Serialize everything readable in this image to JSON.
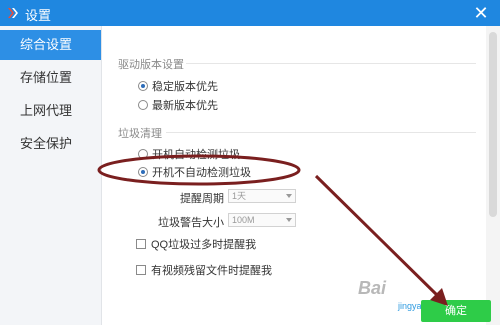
{
  "window": {
    "title": "设置",
    "close_glyph": "✕",
    "accent": "#1f87e0"
  },
  "sidebar": {
    "items": [
      {
        "label": "综合设置",
        "active": true
      },
      {
        "label": "存储位置",
        "active": false
      },
      {
        "label": "上网代理",
        "active": false
      },
      {
        "label": "安全保护",
        "active": false
      }
    ]
  },
  "driver_section": {
    "title": "驱动版本设置",
    "options": [
      {
        "label": "稳定版本优先",
        "checked": true
      },
      {
        "label": "最新版本优先",
        "checked": false
      }
    ]
  },
  "junk_section": {
    "title": "垃圾清理",
    "options": [
      {
        "label": "开机自动检测垃圾",
        "checked": false
      },
      {
        "label": "开机不自动检测垃圾",
        "checked": true
      }
    ],
    "remind_period": {
      "label": "提醒周期",
      "value": "1天"
    },
    "warn_size": {
      "label": "垃圾警告大小",
      "value": "100M"
    },
    "checks": [
      {
        "label": "QQ垃圾过多时提醒我",
        "checked": false
      },
      {
        "label": "有视频残留文件时提醒我",
        "checked": false
      }
    ]
  },
  "buttons": {
    "ok_label": "确定",
    "ok_color": "#2ecc48"
  },
  "watermark": {
    "text": "Bai",
    "sub": "jingyan.baidu.com"
  },
  "annotation": {
    "color": "#7a1f1f"
  }
}
